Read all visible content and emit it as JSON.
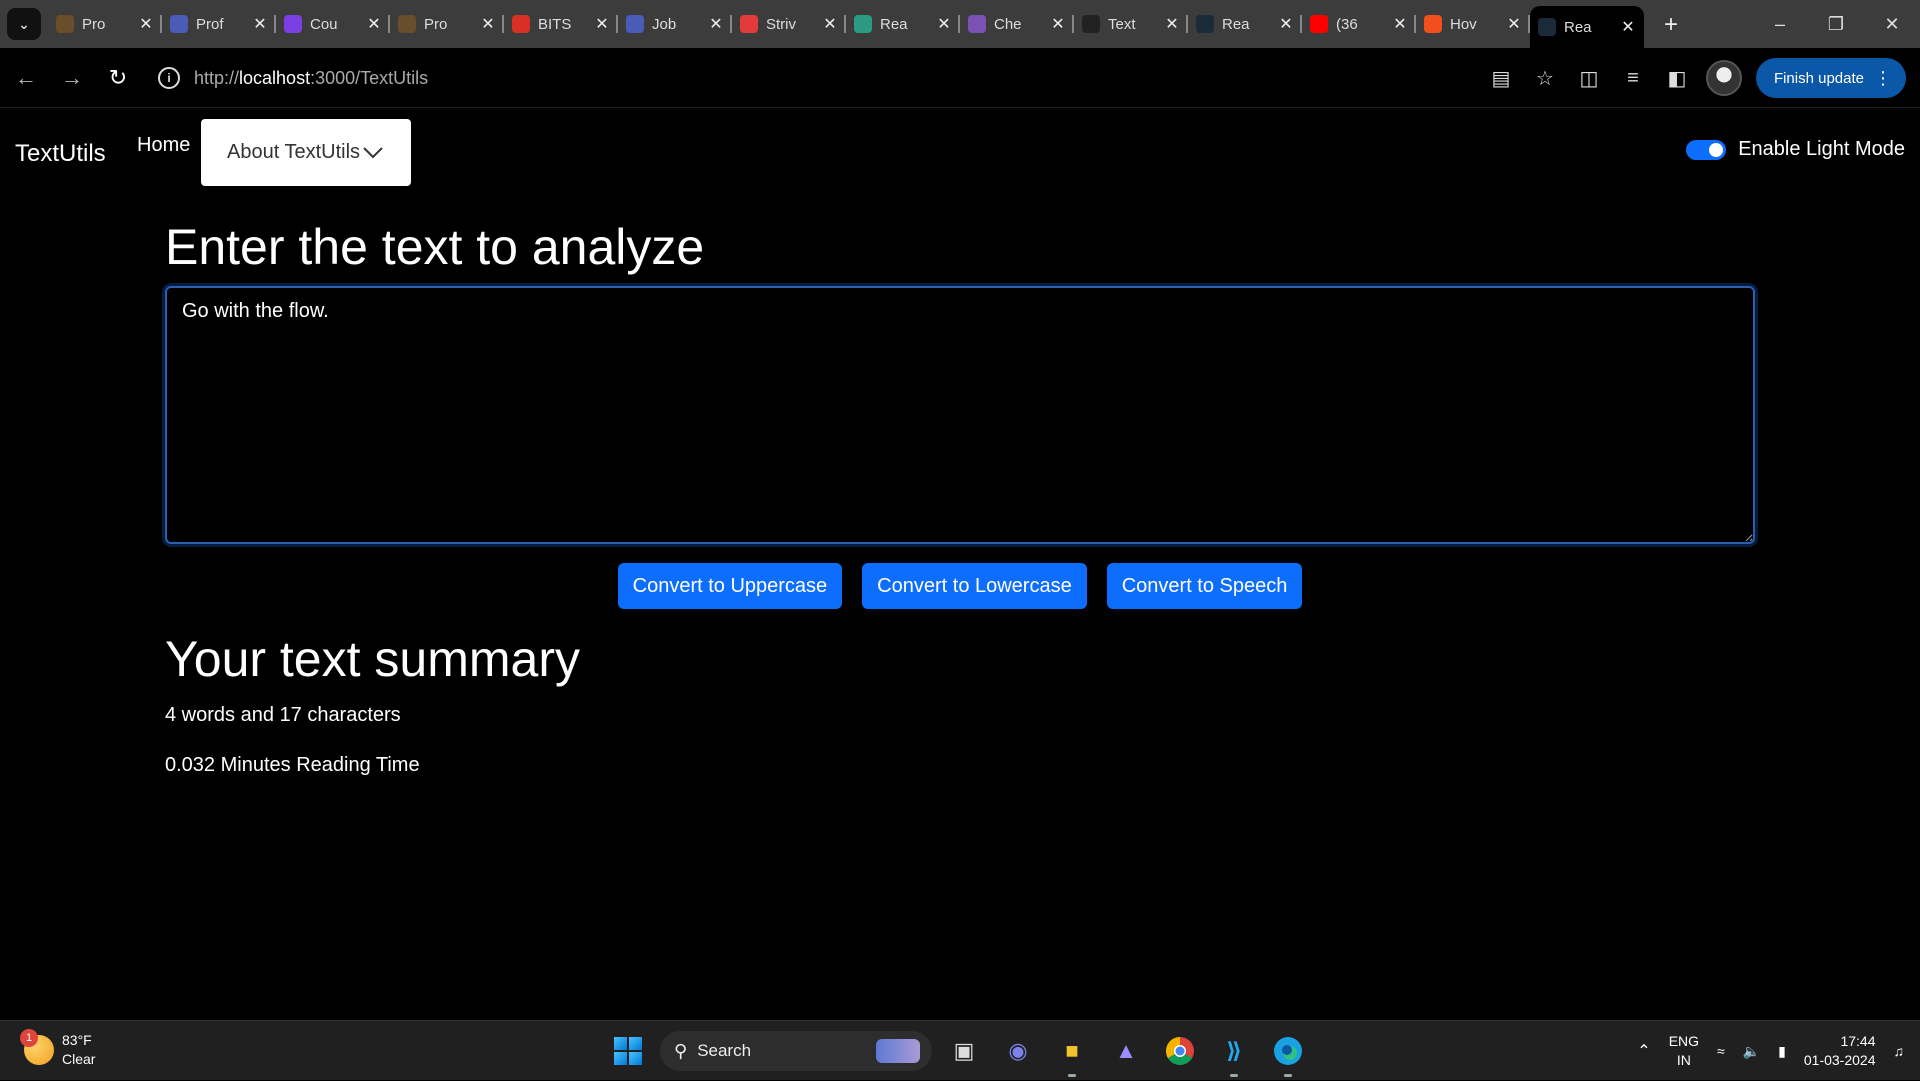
{
  "browser": {
    "tabs": [
      {
        "label": "Pro",
        "favicon_color": "#6a4e2c",
        "icon": "sync-icon"
      },
      {
        "label": "Prof",
        "favicon_color": "#4b5bb8",
        "icon": "link-icon"
      },
      {
        "label": "Cou",
        "favicon_color": "#7b3fe4",
        "icon": "u-icon"
      },
      {
        "label": "Pro",
        "favicon_color": "#6a4e2c",
        "icon": "sync-icon"
      },
      {
        "label": "BITS",
        "favicon_color": "#d93025",
        "icon": "gmail-icon"
      },
      {
        "label": "Job",
        "favicon_color": "#4b5bb8",
        "icon": "link-icon"
      },
      {
        "label": "Striv",
        "favicon_color": "#e23b3b",
        "icon": "tuf-icon"
      },
      {
        "label": "Rea",
        "favicon_color": "#2b9a85",
        "icon": "chatgpt-icon"
      },
      {
        "label": "Che",
        "favicon_color": "#7952b3",
        "icon": "bootstrap-icon"
      },
      {
        "label": "Text",
        "favicon_color": "#222222",
        "icon": "github-icon"
      },
      {
        "label": "Rea",
        "favicon_color": "#1b2a38",
        "icon": "react-icon"
      },
      {
        "label": "(36",
        "favicon_color": "#ff0000",
        "icon": "youtube-icon"
      },
      {
        "label": "Hov",
        "favicon_color": "#f24e1e",
        "icon": "square-icon"
      },
      {
        "label": "Rea",
        "favicon_color": "#1b2a38",
        "icon": "react-icon",
        "active": true
      }
    ],
    "url_host": "localhost",
    "url_prefix": "http://",
    "url_suffix": ":3000/TextUtils",
    "finish_update_label": "Finish update"
  },
  "app": {
    "brand": "TextUtils",
    "nav_home": "Home",
    "nav_about": "About TextUtils",
    "mode_toggle_label": "Enable Light Mode",
    "form_heading": "Enter the text to analyze",
    "textarea_value": "Go with the flow.",
    "buttons": {
      "uppercase": "Convert to Uppercase",
      "lowercase": "Convert to Lowercase",
      "speech": "Convert to Speech"
    },
    "summary_heading": "Your text summary",
    "word_char_summary": "4 words and 17 characters",
    "reading_time": "0.032 Minutes Reading Time",
    "accent_color": "#0d6efd"
  },
  "taskbar": {
    "weather_temp": "83°F",
    "weather_cond": "Clear",
    "weather_badge": "1",
    "search_label": "Search",
    "lang_top": "ENG",
    "lang_bottom": "IN",
    "time": "17:44",
    "date": "01-03-2024"
  }
}
